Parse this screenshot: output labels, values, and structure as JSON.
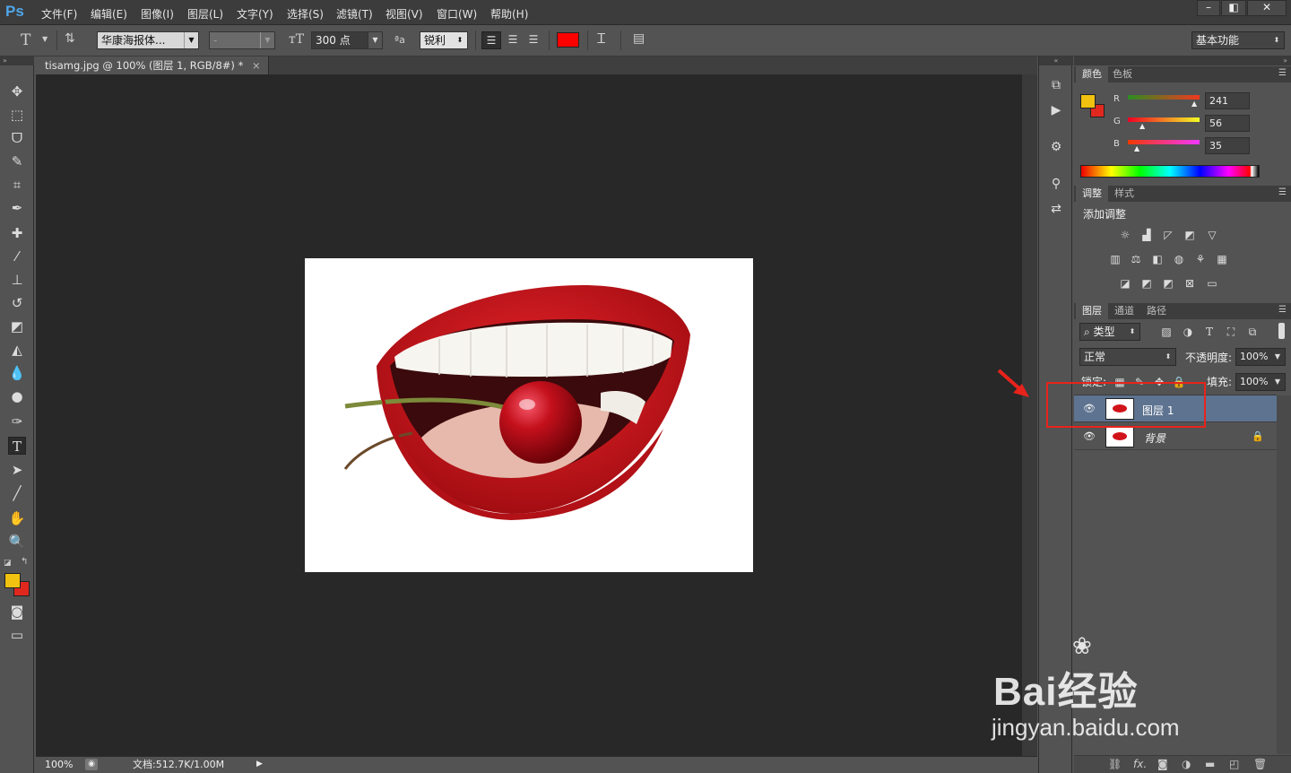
{
  "app": {
    "logo": "Ps"
  },
  "menu": [
    "文件(F)",
    "编辑(E)",
    "图像(I)",
    "图层(L)",
    "文字(Y)",
    "选择(S)",
    "滤镜(T)",
    "视图(V)",
    "窗口(W)",
    "帮助(H)"
  ],
  "window_controls": {
    "minimize": "–",
    "restore": "◧",
    "close": "✕"
  },
  "options": {
    "tool_icon": "T",
    "font_family": "华康海报体...",
    "font_style": "-",
    "font_size": "300 点",
    "aa_label": "ªa",
    "anti_alias": "锐利",
    "text_color": "#ff0000",
    "workspace": "基本功能"
  },
  "document": {
    "tab_title": "tisamg.jpg @ 100% (图层 1, RGB/8#) *",
    "tab_close": "×",
    "zoom": "100%",
    "doc_info": "文档:512.7K/1.00M"
  },
  "colors": {
    "foreground": "#f1c20f",
    "background": "#e0281f"
  },
  "color_panel": {
    "tabs": [
      "颜色",
      "色板"
    ],
    "channels": [
      {
        "name": "R",
        "value": "241"
      },
      {
        "name": "G",
        "value": "56"
      },
      {
        "name": "B",
        "value": "35"
      }
    ]
  },
  "adjust_panel": {
    "tabs": [
      "调整",
      "样式"
    ],
    "title": "添加调整"
  },
  "layers_panel": {
    "tabs": [
      "图层",
      "通道",
      "路径"
    ],
    "filter_kind": "类型",
    "blend_mode": "正常",
    "opacity_label": "不透明度:",
    "opacity": "100%",
    "lock_label": "锁定:",
    "fill_label": "填充:",
    "fill": "100%",
    "layers": [
      {
        "name": "图层 1",
        "selected": true,
        "visible": true
      },
      {
        "name": "背景",
        "selected": false,
        "visible": true,
        "locked": true
      }
    ],
    "footer_icons": [
      "link-icon",
      "fx-icon",
      "mask-icon",
      "adjustment-icon",
      "folder-icon",
      "new-layer-icon",
      "trash-icon"
    ]
  },
  "watermark": {
    "brand": "Bai经验",
    "url": "jingyan.baidu.com"
  },
  "annotation": {
    "highlight_color": "#e8231c"
  }
}
